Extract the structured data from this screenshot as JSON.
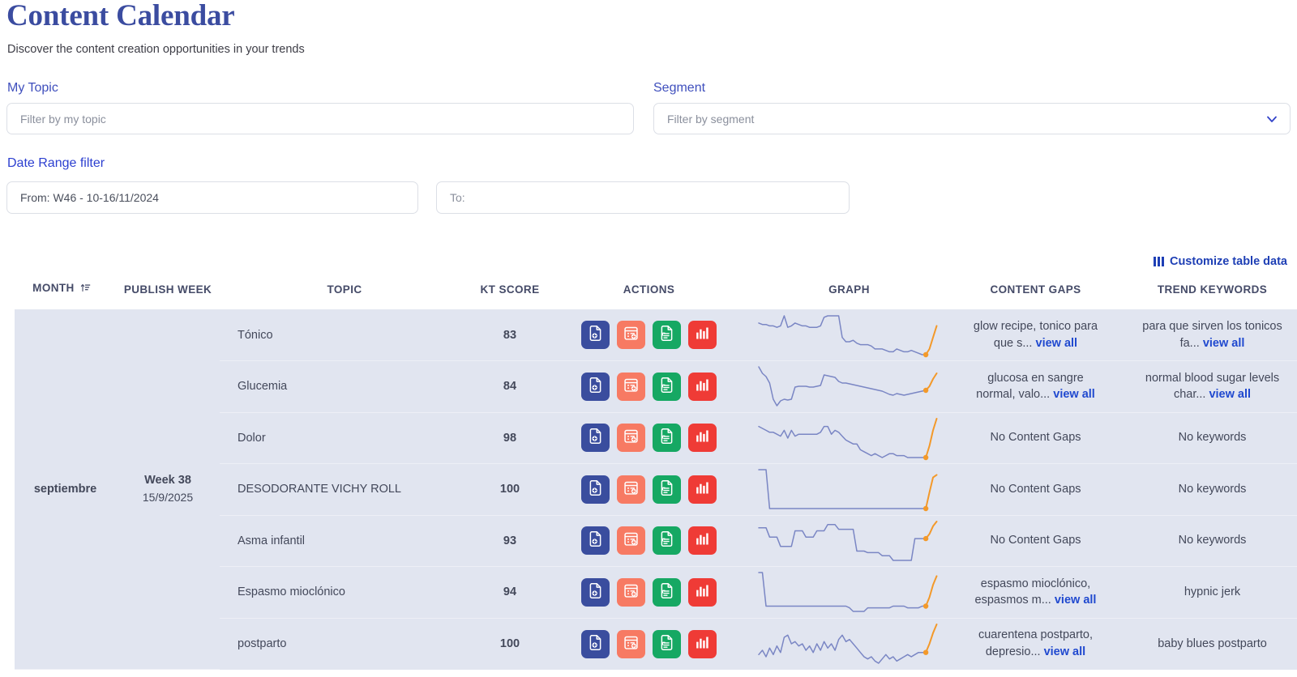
{
  "header": {
    "title": "Content Calendar",
    "subtitle": "Discover the content creation opportunities in your trends"
  },
  "filters": {
    "topic": {
      "label": "My Topic",
      "placeholder": "Filter by my topic",
      "value": ""
    },
    "segment": {
      "label": "Segment",
      "placeholder": "Filter by segment",
      "value": "",
      "icon": "chevron-down-icon"
    },
    "date_range": {
      "label": "Date Range filter",
      "from": {
        "value": "From: W46 - 10-16/11/2024"
      },
      "to": {
        "placeholder": "To:",
        "value": ""
      }
    }
  },
  "toolbar": {
    "customize_label": "Customize table data",
    "customize_icon": "columns-icon"
  },
  "table": {
    "columns": [
      {
        "key": "month",
        "label": "MONTH",
        "sort_icon": "sort-ascending-icon"
      },
      {
        "key": "publish_week",
        "label": "PUBLISH WEEK"
      },
      {
        "key": "topic",
        "label": "TOPIC"
      },
      {
        "key": "kt_score",
        "label": "KT SCORE"
      },
      {
        "key": "actions",
        "label": "ACTIONS"
      },
      {
        "key": "graph",
        "label": "GRAPH"
      },
      {
        "key": "content_gaps",
        "label": "CONTENT GAPS"
      },
      {
        "key": "trend_keywords",
        "label": "TREND KEYWORDS"
      }
    ],
    "group": {
      "month": "septiembre",
      "week_name": "Week 38",
      "week_date": "15/9/2025"
    },
    "actions": [
      {
        "name": "create-brief-button",
        "icon": "document-add-icon",
        "color": "#3a4d9e"
      },
      {
        "name": "add-to-calendar-button",
        "icon": "calendar-add-icon",
        "color": "#f77a63"
      },
      {
        "name": "document-link-button",
        "icon": "document-link-icon",
        "color": "#16a863"
      },
      {
        "name": "view-stats-button",
        "icon": "bar-chart-icon",
        "color": "#ef3b36"
      }
    ],
    "rows": [
      {
        "topic": "Tónico",
        "kt_score": "83",
        "content_gaps": "glow recipe, tonico para que s...",
        "content_gaps_link": "view all",
        "trend_keywords": "para que sirven los tonicos fa...",
        "trend_keywords_link": "view all"
      },
      {
        "topic": "Glucemia",
        "kt_score": "84",
        "content_gaps": "glucosa en sangre normal, valo...",
        "content_gaps_link": "view all",
        "trend_keywords": "normal blood sugar levels char...",
        "trend_keywords_link": "view all"
      },
      {
        "topic": "Dolor",
        "kt_score": "98",
        "content_gaps": "No Content Gaps",
        "content_gaps_link": "",
        "trend_keywords": "No keywords",
        "trend_keywords_link": ""
      },
      {
        "topic": "DESODORANTE VICHY ROLL",
        "kt_score": "100",
        "content_gaps": "No Content Gaps",
        "content_gaps_link": "",
        "trend_keywords": "No keywords",
        "trend_keywords_link": ""
      },
      {
        "topic": "Asma infantil",
        "kt_score": "93",
        "content_gaps": "No Content Gaps",
        "content_gaps_link": "",
        "trend_keywords": "No keywords",
        "trend_keywords_link": ""
      },
      {
        "topic": "Espasmo mioclónico",
        "kt_score": "94",
        "content_gaps": "espasmo mioclónico, espasmos m...",
        "content_gaps_link": "view all",
        "trend_keywords": "hypnic jerk",
        "trend_keywords_link": ""
      },
      {
        "topic": "postparto",
        "kt_score": "100",
        "content_gaps": "cuarentena postparto, depresio...",
        "content_gaps_link": "view all",
        "trend_keywords": "baby blues postparto",
        "trend_keywords_link": ""
      }
    ]
  },
  "chart_data": {
    "type": "line",
    "title": "Trend sparklines per topic",
    "xlabel": "",
    "ylabel": "",
    "grid": false,
    "legend": "none",
    "series_colors": {
      "history": "#7a86c4",
      "forecast": "#f3992a"
    },
    "series": [
      {
        "name": "Tónico",
        "history": [
          60,
          59,
          59,
          58,
          58,
          57,
          58,
          65,
          57,
          58,
          60,
          59,
          58,
          58,
          57,
          57,
          57,
          58,
          64,
          65,
          65,
          65,
          65,
          50,
          47,
          47,
          48,
          46,
          45,
          45,
          45,
          44,
          42,
          42,
          42,
          41,
          40,
          40,
          42,
          41,
          40,
          40,
          41,
          40,
          39,
          38,
          38
        ],
        "forecast": [
          38,
          42,
          50,
          58
        ]
      },
      {
        "name": "Glucemia",
        "history": [
          70,
          62,
          58,
          50,
          30,
          22,
          28,
          30,
          29,
          30,
          45,
          46,
          46,
          46,
          45,
          45,
          46,
          47,
          60,
          59,
          58,
          57,
          52,
          50,
          50,
          49,
          48,
          47,
          46,
          45,
          44,
          43,
          42,
          41,
          40,
          38,
          36,
          35,
          37,
          36,
          35,
          36,
          37,
          38,
          39,
          40,
          41
        ],
        "forecast": [
          41,
          46,
          55,
          62
        ]
      },
      {
        "name": "Dolor",
        "history": [
          62,
          61,
          60,
          59,
          59,
          58,
          57,
          60,
          56,
          60,
          57,
          58,
          58,
          58,
          58,
          58,
          58,
          59,
          62,
          62,
          58,
          60,
          59,
          57,
          55,
          54,
          53,
          53,
          50,
          49,
          48,
          47,
          48,
          47,
          46,
          47,
          48,
          48,
          47,
          47,
          47,
          46,
          46,
          46,
          46,
          46,
          46
        ],
        "forecast": [
          46,
          52,
          60,
          66
        ]
      },
      {
        "name": "DESODORANTE VICHY ROLL",
        "history": [
          80,
          80,
          80,
          20,
          20,
          20,
          20,
          20,
          20,
          20,
          20,
          20,
          20,
          20,
          20,
          20,
          20,
          20,
          20,
          20,
          20,
          20,
          20,
          20,
          20,
          20,
          20,
          20,
          20,
          20,
          20,
          20,
          20,
          20,
          20,
          20,
          20,
          20,
          20,
          20,
          20,
          20,
          20,
          20,
          20,
          20,
          20
        ],
        "forecast": [
          20,
          45,
          68,
          72
        ]
      },
      {
        "name": "Asma infantil",
        "history": [
          72,
          72,
          72,
          60,
          60,
          60,
          48,
          48,
          48,
          48,
          68,
          68,
          68,
          60,
          60,
          60,
          68,
          68,
          68,
          76,
          76,
          76,
          70,
          70,
          70,
          70,
          70,
          42,
          42,
          42,
          40,
          40,
          40,
          40,
          36,
          36,
          36,
          30,
          30,
          30,
          30,
          30,
          30,
          58,
          58,
          58,
          58
        ],
        "forecast": [
          58,
          64,
          74,
          80
        ]
      },
      {
        "name": "Espasmo mioclónico",
        "history": [
          78,
          78,
          40,
          40,
          40,
          40,
          40,
          40,
          40,
          40,
          40,
          40,
          40,
          40,
          40,
          40,
          40,
          40,
          40,
          40,
          40,
          40,
          40,
          40,
          40,
          38,
          34,
          34,
          34,
          34,
          38,
          38,
          38,
          38,
          38,
          38,
          38,
          40,
          40,
          40,
          40,
          38,
          38,
          38,
          38,
          40,
          40
        ],
        "forecast": [
          40,
          50,
          64,
          74
        ]
      },
      {
        "name": "postparto",
        "history": [
          48,
          52,
          46,
          54,
          48,
          56,
          50,
          64,
          66,
          58,
          60,
          56,
          58,
          52,
          56,
          50,
          58,
          52,
          60,
          54,
          58,
          52,
          62,
          66,
          60,
          62,
          58,
          54,
          50,
          46,
          44,
          46,
          42,
          40,
          44,
          48,
          44,
          46,
          42,
          44,
          46,
          48,
          46,
          48,
          50,
          50,
          50
        ],
        "forecast": [
          50,
          58,
          68,
          76
        ]
      }
    ]
  }
}
